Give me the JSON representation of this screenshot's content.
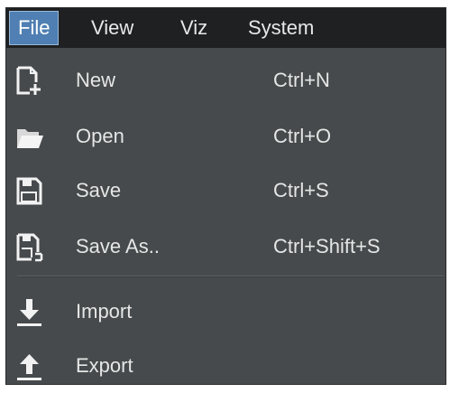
{
  "menubar": {
    "items": [
      {
        "label": "File",
        "active": true
      },
      {
        "label": "View",
        "active": false
      },
      {
        "label": "Viz",
        "active": false
      },
      {
        "label": "System",
        "active": false
      }
    ]
  },
  "file_menu": {
    "items": [
      {
        "label": "New",
        "shortcut": "Ctrl+N",
        "icon": "new-file-icon"
      },
      {
        "label": "Open",
        "shortcut": "Ctrl+O",
        "icon": "folder-open-icon"
      },
      {
        "label": "Save",
        "shortcut": "Ctrl+S",
        "icon": "floppy-icon"
      },
      {
        "label": "Save As..",
        "shortcut": "Ctrl+Shift+S",
        "icon": "save-as-icon"
      },
      {
        "label": "Import",
        "shortcut": "",
        "icon": "import-arrow-icon"
      },
      {
        "label": "Export",
        "shortcut": "",
        "icon": "export-arrow-icon"
      }
    ]
  },
  "colors": {
    "menubar_bg": "#1e2021",
    "menu_bg": "#464a4c",
    "active_bg": "#4f7fb3",
    "text": "#e6e6e6"
  }
}
